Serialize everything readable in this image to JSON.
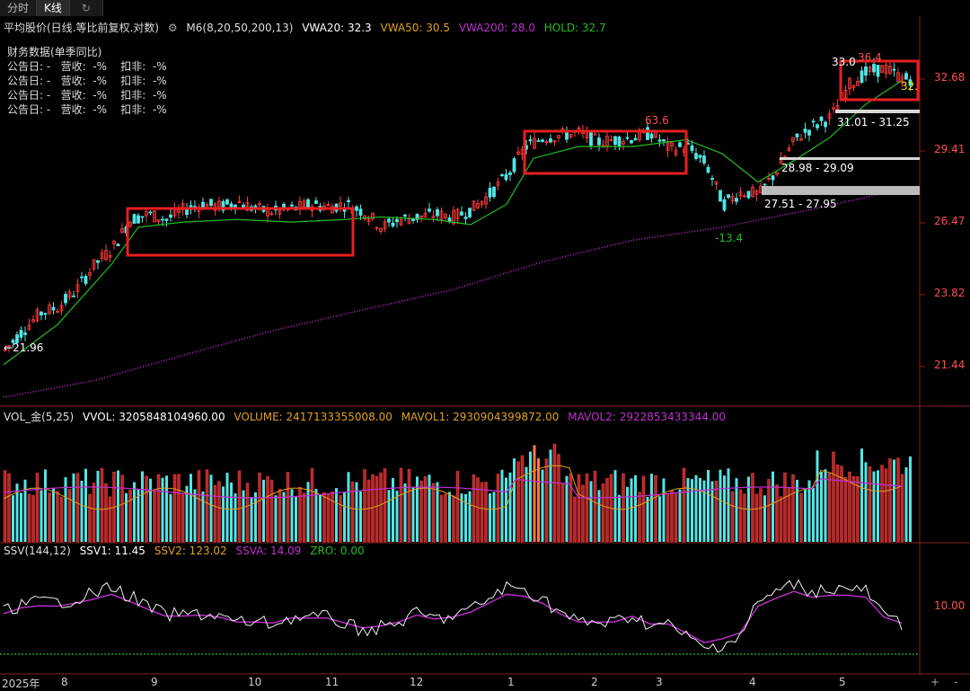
{
  "tabs": [
    "分时",
    "K线"
  ],
  "main": {
    "title": "平均股价(日线.等比前复权.对数)",
    "indicator": "M6(8,20,50,200,13)",
    "vwa20": "VWA20: 32.3",
    "vwa50": "VWA50: 30.5",
    "vwa200": "VWA200: 28.0",
    "hold": "HOLD: 32.7"
  },
  "finance": {
    "title": "财务数据(单季同比)",
    "rows": [
      "公告日: -   营收:  -%    扣非:  -%",
      "公告日: -   营收:  -%    扣非:  -%",
      "公告日: -   营收:  -%    扣非:  -%",
      "公告日: -   营收:  -%    扣非:  -%"
    ]
  },
  "yaxis": [
    "32.68",
    "29.41",
    "26.47",
    "23.82",
    "21.44"
  ],
  "xaxis": [
    "2025年",
    "8",
    "9",
    "10",
    "11",
    "12",
    "1",
    "2",
    "3",
    "4",
    "5"
  ],
  "marks": {
    "low_start": "21.96",
    "high_feb": "63.6",
    "low_mar": "-13.4",
    "peak_may": "36.4",
    "peak_may_left": "33.0",
    "cur_tag": "32.",
    "zone1": "31.01 - 31.25",
    "zone2": "28.98 - 29.09",
    "zone3": "27.51 - 27.95"
  },
  "vol": {
    "title": "VOL_金(5,25)",
    "vvol": "VVOL: 3205848104960.00",
    "volume": "VOLUME: 2417133355008.00",
    "mavol1": "MAVOL1: 2930904399872.00",
    "mavol2": "MAVOL2: 2922853433344.00"
  },
  "ssv": {
    "title": "SSV(144,12)",
    "ssv1": "SSV1: 11.45",
    "ssv2": "SSV2: 123.02",
    "ssva": "SSVA: 14.09",
    "zro": "ZRO: 0.00",
    "ylabel": "10.00"
  },
  "buttons": {
    "plus": "+",
    "minus": "-"
  },
  "colors": {
    "up": "#ff3b3b",
    "down": "#52e5e5",
    "ma": "#1fbf1f",
    "ma200": "#c030d0",
    "volume": "#e0a020",
    "box": "#e81f1f"
  },
  "chart_data": {
    "type": "candlestick",
    "title": "平均股价(日线.等比前复权.对数)",
    "ylabels": [
      "32.68",
      "29.41",
      "26.47",
      "23.82",
      "21.44"
    ],
    "xlabels": [
      "8",
      "9",
      "10",
      "11",
      "12",
      "1",
      "2",
      "3",
      "4",
      "5"
    ],
    "close_path": [
      [
        0,
        21.96
      ],
      [
        20,
        22.6
      ],
      [
        40,
        23.2
      ],
      [
        60,
        23.4
      ],
      [
        80,
        24.0
      ],
      [
        100,
        24.9
      ],
      [
        120,
        25.5
      ],
      [
        140,
        26.6
      ],
      [
        160,
        26.8
      ],
      [
        180,
        26.6
      ],
      [
        200,
        27.0
      ],
      [
        220,
        27.2
      ],
      [
        240,
        27.1
      ],
      [
        260,
        27.3
      ],
      [
        280,
        27.0
      ],
      [
        300,
        26.9
      ],
      [
        320,
        27.0
      ],
      [
        340,
        27.2
      ],
      [
        360,
        27.1
      ],
      [
        380,
        27.2
      ],
      [
        400,
        26.9
      ],
      [
        420,
        26.3
      ],
      [
        440,
        26.6
      ],
      [
        460,
        26.7
      ],
      [
        480,
        26.8
      ],
      [
        500,
        26.7
      ],
      [
        520,
        27.0
      ],
      [
        540,
        27.6
      ],
      [
        560,
        28.4
      ],
      [
        580,
        29.6
      ],
      [
        600,
        30.0
      ],
      [
        620,
        30.1
      ],
      [
        640,
        30.2
      ],
      [
        660,
        29.8
      ],
      [
        680,
        29.9
      ],
      [
        700,
        30.0
      ],
      [
        720,
        30.2
      ],
      [
        740,
        29.5
      ],
      [
        760,
        29.6
      ],
      [
        780,
        28.9
      ],
      [
        800,
        27.2
      ],
      [
        820,
        27.7
      ],
      [
        840,
        27.6
      ],
      [
        860,
        28.6
      ],
      [
        880,
        29.9
      ],
      [
        900,
        30.5
      ],
      [
        920,
        30.9
      ],
      [
        940,
        32.4
      ],
      [
        960,
        33.0
      ],
      [
        980,
        33.2
      ],
      [
        1000,
        32.7
      ]
    ],
    "ma_path": [
      [
        0,
        21.5
      ],
      [
        60,
        22.8
      ],
      [
        120,
        24.9
      ],
      [
        150,
        26.3
      ],
      [
        200,
        26.5
      ],
      [
        260,
        26.6
      ],
      [
        320,
        26.5
      ],
      [
        380,
        26.6
      ],
      [
        420,
        26.7
      ],
      [
        480,
        26.6
      ],
      [
        520,
        26.4
      ],
      [
        560,
        27.2
      ],
      [
        590,
        29.1
      ],
      [
        640,
        29.6
      ],
      [
        700,
        29.6
      ],
      [
        760,
        29.9
      ],
      [
        800,
        29.3
      ],
      [
        840,
        28.1
      ],
      [
        880,
        29.0
      ],
      [
        920,
        30.0
      ],
      [
        960,
        31.5
      ],
      [
        1000,
        32.6
      ]
    ],
    "ma200_path": [
      [
        0,
        20.5
      ],
      [
        100,
        21.0
      ],
      [
        200,
        21.8
      ],
      [
        300,
        22.6
      ],
      [
        400,
        23.3
      ],
      [
        500,
        24.0
      ],
      [
        600,
        25.0
      ],
      [
        700,
        25.8
      ],
      [
        800,
        26.3
      ],
      [
        900,
        27.0
      ],
      [
        1000,
        27.8
      ]
    ],
    "ssv_labels": [
      "10.00"
    ]
  }
}
